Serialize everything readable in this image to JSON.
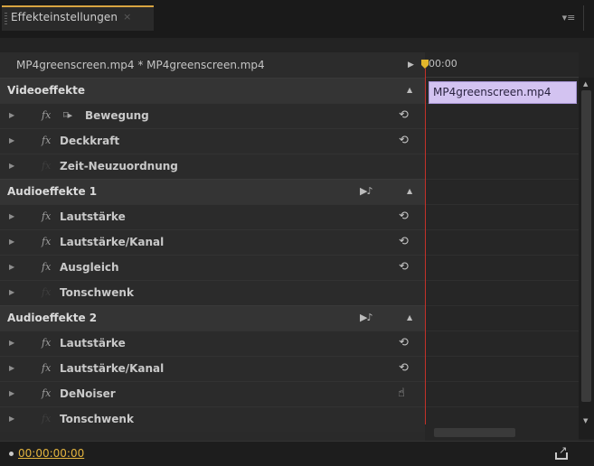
{
  "tab": {
    "title": "Effekteinstellungen",
    "close": "×",
    "menu_icon": "▾≡"
  },
  "clip_header": {
    "label": "MP4greenscreen.mp4 * MP4greenscreen.mp4",
    "expand_arrow": "▶"
  },
  "timeline": {
    "ruler_time": "00:00",
    "clip_name": "MP4greenscreen.mp4"
  },
  "sections": [
    {
      "label": "Videoeffekte",
      "has_audio_play": false,
      "effects": [
        {
          "name": "Bewegung",
          "fx_active": true,
          "motion_icon": true,
          "control": "reset"
        },
        {
          "name": "Deckkraft",
          "fx_active": true,
          "motion_icon": false,
          "control": "reset"
        },
        {
          "name": "Zeit-Neuzuordnung",
          "fx_active": false,
          "motion_icon": false,
          "control": "none"
        }
      ]
    },
    {
      "label": "Audioeffekte 1",
      "has_audio_play": true,
      "effects": [
        {
          "name": "Lautstärke",
          "fx_active": true,
          "motion_icon": false,
          "control": "reset"
        },
        {
          "name": "Lautstärke/Kanal",
          "fx_active": true,
          "motion_icon": false,
          "control": "reset"
        },
        {
          "name": "Ausgleich",
          "fx_active": true,
          "motion_icon": false,
          "control": "reset"
        },
        {
          "name": "Tonschwenk",
          "fx_active": false,
          "motion_icon": false,
          "control": "none"
        }
      ]
    },
    {
      "label": "Audioeffekte 2",
      "has_audio_play": true,
      "effects": [
        {
          "name": "Lautstärke",
          "fx_active": true,
          "motion_icon": false,
          "control": "reset"
        },
        {
          "name": "Lautstärke/Kanal",
          "fx_active": true,
          "motion_icon": false,
          "control": "reset"
        },
        {
          "name": "DeNoiser",
          "fx_active": true,
          "motion_icon": false,
          "control": "hand"
        },
        {
          "name": "Tonschwenk",
          "fx_active": false,
          "motion_icon": false,
          "control": "none"
        }
      ]
    }
  ],
  "glyphs": {
    "fx": "fx",
    "disclose": "▶",
    "collapse": "▲",
    "audio_play": "▶♪",
    "reset": "⟲",
    "hand": "☝",
    "motion": "⌑▸"
  },
  "footer": {
    "timecode": "00:00:00:00"
  },
  "colors": {
    "accent_tab": "#d8a441",
    "timecode": "#e4b43e",
    "playhead": "#c2312a",
    "clip_bar": "#d3c3f1"
  }
}
